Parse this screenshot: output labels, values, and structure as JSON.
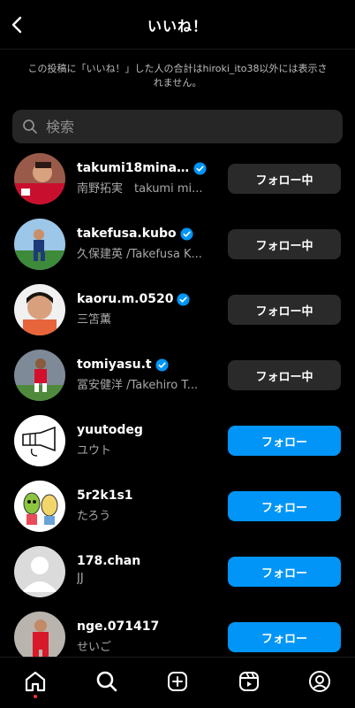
{
  "header": {
    "title": "いいね！",
    "back_icon": "chevron-left-icon"
  },
  "notice": {
    "text": "この投稿に「いいね！」した人の合計はhiroki_ito38以外には表示されません。"
  },
  "search": {
    "placeholder": "検索",
    "value": ""
  },
  "colors": {
    "follow": "#0095f6",
    "following": "#2a2a2a",
    "verified": "#0095f6",
    "notification": "#ff3040"
  },
  "users": [
    {
      "username": "takumi18minam...",
      "full_name": "南野拓実　takumi mi...",
      "verified": true,
      "button": "フォロー中",
      "state": "following"
    },
    {
      "username": "takefusa.kubo",
      "full_name": "久保建英 /Takefusa K...",
      "verified": true,
      "button": "フォロー中",
      "state": "following"
    },
    {
      "username": "kaoru.m.0520",
      "full_name": "三笘薫",
      "verified": true,
      "button": "フォロー中",
      "state": "following"
    },
    {
      "username": "tomiyasu.t",
      "full_name": "冨安健洋 /Takehiro T...",
      "verified": true,
      "button": "フォロー中",
      "state": "following"
    },
    {
      "username": "yuutodeg",
      "full_name": "ユウト",
      "verified": false,
      "button": "フォロー",
      "state": "follow"
    },
    {
      "username": "5r2k1s1",
      "full_name": "たろう",
      "verified": false,
      "button": "フォロー",
      "state": "follow"
    },
    {
      "username": "178.chan",
      "full_name": "JJ",
      "verified": false,
      "button": "フォロー",
      "state": "follow"
    },
    {
      "username": "nge.071417",
      "full_name": "せいご",
      "verified": false,
      "button": "フォロー",
      "state": "follow"
    }
  ],
  "tabbar": [
    {
      "name": "home-tab",
      "icon": "home-icon",
      "active": true
    },
    {
      "name": "search-tab",
      "icon": "search-icon"
    },
    {
      "name": "create-tab",
      "icon": "plus-square-icon"
    },
    {
      "name": "reels-tab",
      "icon": "reels-icon"
    },
    {
      "name": "profile-tab",
      "icon": "profile-icon"
    }
  ]
}
